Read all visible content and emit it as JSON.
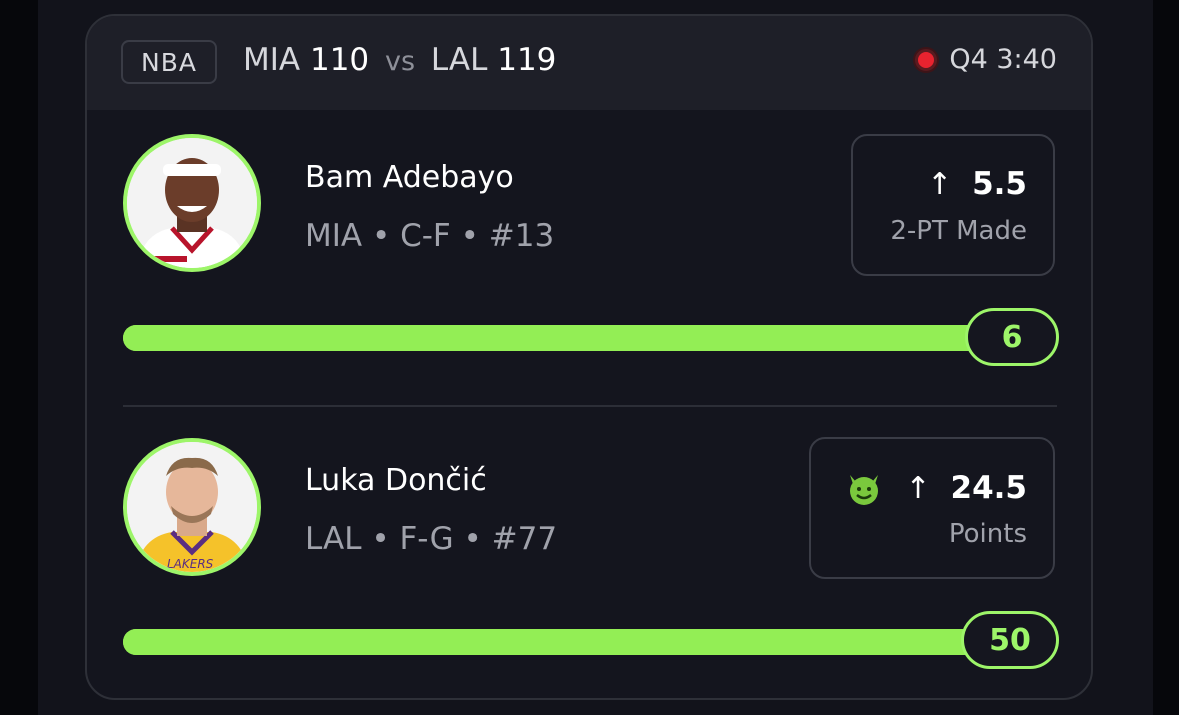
{
  "game": {
    "league": "NBA",
    "away_team": "MIA",
    "away_score": "110",
    "vs": "vs",
    "home_team": "LAL",
    "home_score": "119",
    "clock": "Q4 3:40",
    "live_color": "#e8232f"
  },
  "players": [
    {
      "name": "Bam Adebayo",
      "meta": "MIA • C-F • #13",
      "direction_icon": "arrow-up-icon",
      "arrow": "↑",
      "line": "5.5",
      "stat": "2-PT Made",
      "current": "6",
      "progress_fraction": 1.0
    },
    {
      "name": "Luka Dončić",
      "meta": "LAL • F-G • #77",
      "badge_icon": "devil-emoji-icon",
      "direction_icon": "arrow-up-icon",
      "arrow": "↑",
      "line": "24.5",
      "stat": "Points",
      "current": "50",
      "progress_fraction": 1.0
    }
  ],
  "colors": {
    "accent": "#9df569",
    "bar": "#93ee55",
    "background": "#14151e"
  }
}
